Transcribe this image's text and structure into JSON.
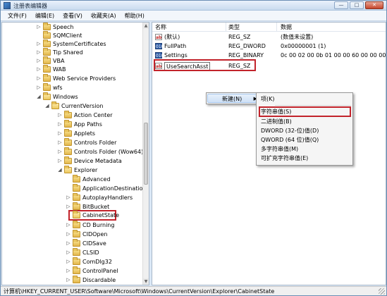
{
  "window": {
    "title": "注册表编辑器",
    "buttons": {
      "minimize": "—",
      "maximize": "□",
      "close": "✕"
    }
  },
  "menu": [
    "文件(F)",
    "编辑(E)",
    "查看(V)",
    "收藏夹(A)",
    "帮助(H)"
  ],
  "tree": [
    {
      "label": "Speech",
      "arrow": "▷"
    },
    {
      "label": "SQMClient",
      "arrow": ""
    },
    {
      "label": "SystemCertificates",
      "arrow": "▷"
    },
    {
      "label": "Tip Shared",
      "arrow": "▷"
    },
    {
      "label": "VBA",
      "arrow": "▷"
    },
    {
      "label": "WAB",
      "arrow": "▷"
    },
    {
      "label": "Web Service Providers",
      "arrow": "▷"
    },
    {
      "label": "wfs",
      "arrow": "▷"
    },
    {
      "label": "Windows",
      "arrow": "◢"
    },
    {
      "label": "CurrentVersion",
      "arrow": "◢"
    },
    {
      "label": "Action Center",
      "arrow": "▷"
    },
    {
      "label": "App Paths",
      "arrow": "▷"
    },
    {
      "label": "Applets",
      "arrow": "▷"
    },
    {
      "label": "Controls Folder",
      "arrow": "▷"
    },
    {
      "label": "Controls Folder (Wow64)",
      "arrow": "▷"
    },
    {
      "label": "Device Metadata",
      "arrow": "▷"
    },
    {
      "label": "Explorer",
      "arrow": "◢"
    },
    {
      "label": "Advanced",
      "arrow": "▷"
    },
    {
      "label": "ApplicationDestinations",
      "arrow": ""
    },
    {
      "label": "AutoplayHandlers",
      "arrow": "▷"
    },
    {
      "label": "BitBucket",
      "arrow": "▷"
    },
    {
      "label": "CabinetState",
      "arrow": ""
    },
    {
      "label": "CD Burning",
      "arrow": "▷"
    },
    {
      "label": "CIDOpen",
      "arrow": "▷"
    },
    {
      "label": "CIDSave",
      "arrow": "▷"
    },
    {
      "label": "CLSID",
      "arrow": "▷"
    },
    {
      "label": "ComDlg32",
      "arrow": "▷"
    },
    {
      "label": "ControlPanel",
      "arrow": "▷"
    },
    {
      "label": "Discardable",
      "arrow": "▷"
    }
  ],
  "values": {
    "headers": {
      "name": "名称",
      "type": "类型",
      "data": "数据"
    },
    "rows": [
      {
        "icon": "ab",
        "name": "(默认)",
        "type": "REG_SZ",
        "data": "(数值未设置)"
      },
      {
        "icon": "010",
        "name": "FullPath",
        "type": "REG_DWORD",
        "data": "0x00000001 (1)"
      },
      {
        "icon": "010",
        "name": "Settings",
        "type": "REG_BINARY",
        "data": "0c 00 02 00 0b 01 00 00 60 00 00 00"
      },
      {
        "icon": "ab",
        "name": "UseSearchAsst",
        "type": "REG_SZ",
        "data": ""
      }
    ]
  },
  "context_menu": {
    "new_label": "新建(N)",
    "new_arrow": "▶",
    "submenu": {
      "key": "项(K)",
      "string": "字符串值(S)",
      "binary": "二进制值(B)",
      "dword": "DWORD (32-位)值(D)",
      "qword": "QWORD (64 位)值(Q)",
      "multi": "多字符串值(M)",
      "expand": "可扩充字符串值(E)"
    }
  },
  "status": {
    "path": "计算机\\HKEY_CURRENT_USER\\Software\\Microsoft\\Windows\\CurrentVersion\\Explorer\\CabinetState"
  },
  "colors": {
    "highlight_border": "#c2232b",
    "title_gradient": "#c9dbef"
  }
}
